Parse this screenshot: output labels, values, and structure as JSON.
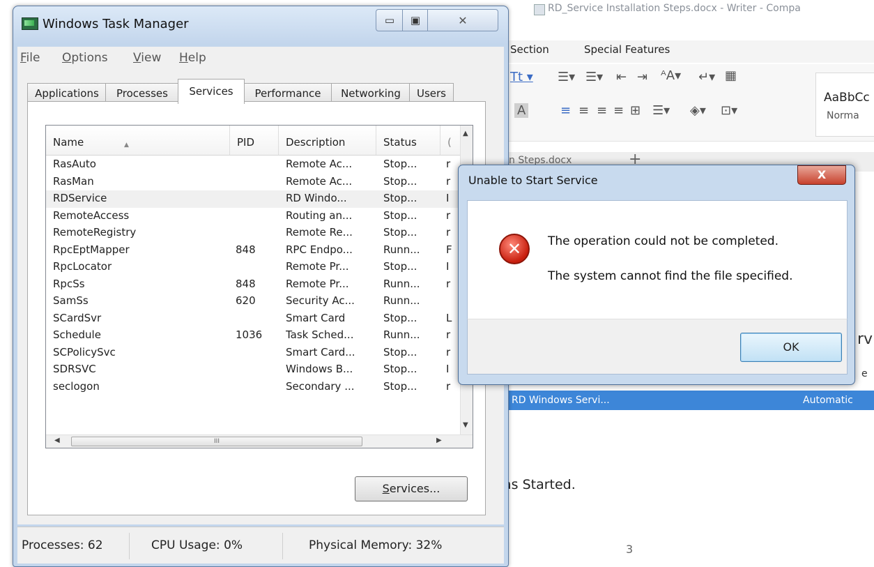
{
  "writer": {
    "title": "RD_Service Installation Steps.docx - Writer - Compa",
    "menus": [
      "Section",
      "Special Features"
    ],
    "ribbon": {
      "style_sample": "AaBbCc",
      "style_name": "Norma"
    },
    "doc_tab": "n Steps.docx",
    "doc_tab_plus": "+",
    "text_fragment_v": "rv",
    "text_fragment_e": "e",
    "selected_row": {
      "name": "RD Windows Servi...",
      "startup": "Automatic"
    },
    "started_text": "as Started.",
    "page_number": "3"
  },
  "task_manager": {
    "title": "Windows Task Manager",
    "window_buttons": {
      "minimize": "▭",
      "maximize": "▣",
      "close": "✕"
    },
    "menu": [
      {
        "label": "File",
        "accel": "F",
        "rest": "ile"
      },
      {
        "label": "Options",
        "accel": "O",
        "rest": "ptions"
      },
      {
        "label": "View",
        "accel": "V",
        "rest": "iew"
      },
      {
        "label": "Help",
        "accel": "H",
        "rest": "elp"
      }
    ],
    "tabs": [
      "Applications",
      "Processes",
      "Services",
      "Performance",
      "Networking",
      "Users"
    ],
    "active_tab": "Services",
    "columns": [
      "Name",
      "PID",
      "Description",
      "Status",
      "("
    ],
    "rows": [
      {
        "name": "RasAuto",
        "pid": "",
        "desc": "Remote Ac...",
        "status": "Stop...",
        "grp": "r"
      },
      {
        "name": "RasMan",
        "pid": "",
        "desc": "Remote Ac...",
        "status": "Stop...",
        "grp": "r"
      },
      {
        "name": "RDService",
        "pid": "",
        "desc": "RD Windo...",
        "status": "Stop...",
        "grp": "I"
      },
      {
        "name": "RemoteAccess",
        "pid": "",
        "desc": "Routing an...",
        "status": "Stop...",
        "grp": "r"
      },
      {
        "name": "RemoteRegistry",
        "pid": "",
        "desc": "Remote Re...",
        "status": "Stop...",
        "grp": "r"
      },
      {
        "name": "RpcEptMapper",
        "pid": "848",
        "desc": "RPC Endpo...",
        "status": "Runn...",
        "grp": "F"
      },
      {
        "name": "RpcLocator",
        "pid": "",
        "desc": "Remote Pr...",
        "status": "Stop...",
        "grp": "I"
      },
      {
        "name": "RpcSs",
        "pid": "848",
        "desc": "Remote Pr...",
        "status": "Runn...",
        "grp": "r"
      },
      {
        "name": "SamSs",
        "pid": "620",
        "desc": "Security Ac...",
        "status": "Runn...",
        "grp": ""
      },
      {
        "name": "SCardSvr",
        "pid": "",
        "desc": "Smart Card",
        "status": "Stop...",
        "grp": "L"
      },
      {
        "name": "Schedule",
        "pid": "1036",
        "desc": "Task Sched...",
        "status": "Runn...",
        "grp": "r"
      },
      {
        "name": "SCPolicySvc",
        "pid": "",
        "desc": "Smart Card...",
        "status": "Stop...",
        "grp": "r"
      },
      {
        "name": "SDRSVC",
        "pid": "",
        "desc": "Windows B...",
        "status": "Stop...",
        "grp": "I"
      },
      {
        "name": "seclogon",
        "pid": "",
        "desc": "Secondary ...",
        "status": "Stop...",
        "grp": "r"
      }
    ],
    "selected_row_index": 2,
    "hscroll_grip": "III",
    "services_button": {
      "accel": "S",
      "rest": "ervices..."
    },
    "statusbar": {
      "processes": "Processes: 62",
      "cpu": "CPU Usage: 0%",
      "memory": "Physical Memory: 32%"
    }
  },
  "dialog": {
    "title": "Unable to Start Service",
    "close_glyph": "X",
    "error_glyph": "✕",
    "message1": "The operation could not be completed.",
    "message2": "The system cannot find the file specified.",
    "ok_label": "OK"
  }
}
